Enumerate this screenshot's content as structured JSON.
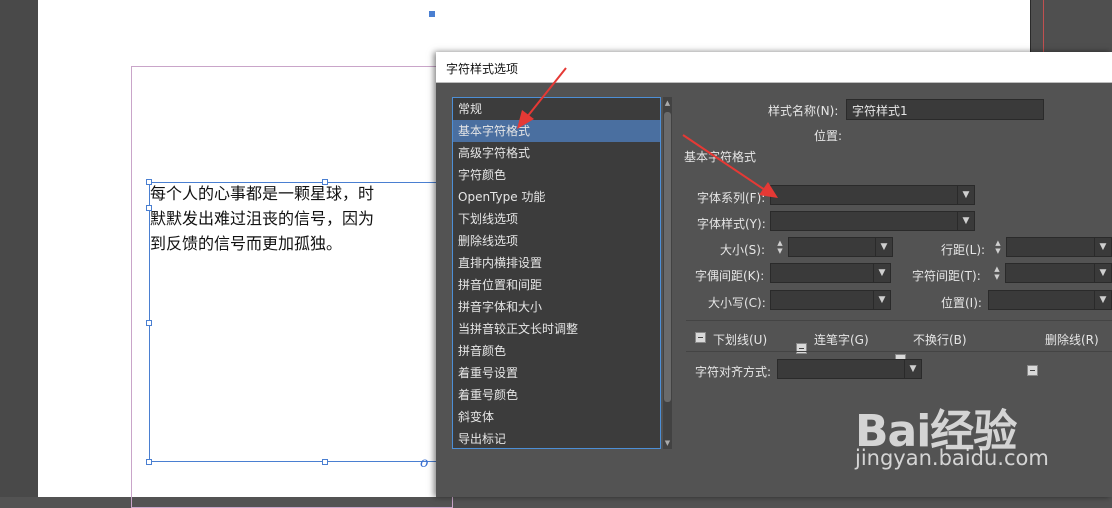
{
  "document": {
    "text": "每个人的心事都是一颗星球，时\n默默发出难过沮丧的信号，因为\n到反馈的信号而更加孤独。",
    "overflow_mark": "o"
  },
  "dialog": {
    "title": "字符样式选项",
    "categories": [
      {
        "label": "常规",
        "selected": false
      },
      {
        "label": "基本字符格式",
        "selected": true
      },
      {
        "label": "高级字符格式",
        "selected": false
      },
      {
        "label": "字符颜色",
        "selected": false
      },
      {
        "label": "OpenType 功能",
        "selected": false
      },
      {
        "label": "下划线选项",
        "selected": false
      },
      {
        "label": "删除线选项",
        "selected": false
      },
      {
        "label": "直排内横排设置",
        "selected": false
      },
      {
        "label": "拼音位置和间距",
        "selected": false
      },
      {
        "label": "拼音字体和大小",
        "selected": false
      },
      {
        "label": "当拼音较正文长时调整",
        "selected": false
      },
      {
        "label": "拼音颜色",
        "selected": false
      },
      {
        "label": "着重号设置",
        "selected": false
      },
      {
        "label": "着重号颜色",
        "selected": false
      },
      {
        "label": "斜变体",
        "selected": false
      },
      {
        "label": "导出标记",
        "selected": false
      }
    ],
    "style_name_label": "样式名称(N):",
    "style_name_value": "字符样式1",
    "location_label": "位置:",
    "section_title": "基本字符格式",
    "font_family_label": "字体系列(F):",
    "font_style_label": "字体样式(Y):",
    "size_label": "大小(S):",
    "leading_label": "行距(L):",
    "kerning_label": "字偶间距(K):",
    "tracking_label": "字符间距(T):",
    "case_label": "大小写(C):",
    "position_label": "位置(I):",
    "underline_label": "下划线(U)",
    "ligatures_label": "连笔字(G)",
    "nobreak_label": "不换行(B)",
    "strikethrough_label": "删除线(R)",
    "char_align_label": "字符对齐方式:"
  },
  "watermark": {
    "logo_text": "Bai经验",
    "url": "jingyan.baidu.com"
  },
  "colors": {
    "selection": "#4a6fa0",
    "frame": "#4a7fd1",
    "annotation_arrow": "#e53935"
  }
}
